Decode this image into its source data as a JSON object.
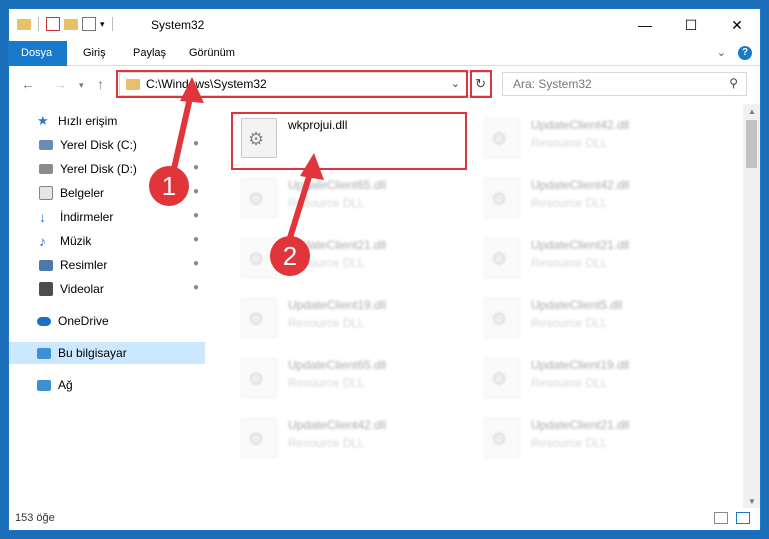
{
  "window": {
    "title": "System32"
  },
  "quick_access_toolbar": {
    "icons": [
      "folder-icon",
      "properties-icon",
      "new-folder-icon",
      "customize-icon"
    ]
  },
  "ribbon": {
    "file_tab": "Dosya",
    "tabs": [
      "Giriş",
      "Paylaş",
      "Görünüm"
    ]
  },
  "address_bar": {
    "path": "C:\\Windows\\System32"
  },
  "search": {
    "placeholder": "Ara: System32"
  },
  "nav": {
    "quick_access": "Hızlı erişim",
    "items": [
      {
        "label": "Yerel Disk (C:)",
        "icon": "drive-icon",
        "color": "#6a8db3"
      },
      {
        "label": "Yerel Disk (D:)",
        "icon": "drive-icon",
        "color": "#8b8b8b"
      },
      {
        "label": "Belgeler",
        "icon": "documents-icon",
        "color": "#7a8796"
      },
      {
        "label": "İndirmeler",
        "icon": "downloads-icon",
        "color": "#2a78d0"
      },
      {
        "label": "Müzik",
        "icon": "music-icon",
        "color": "#2a78d0"
      },
      {
        "label": "Resimler",
        "icon": "pictures-icon",
        "color": "#4b7aa8"
      },
      {
        "label": "Videolar",
        "icon": "videos-icon",
        "color": "#4d4d4d"
      }
    ],
    "onedrive": "OneDrive",
    "this_pc": "Bu bilgisayar",
    "network": "Ağ"
  },
  "files": {
    "highlighted": {
      "name": "wkprojui.dll",
      "type": ""
    },
    "items": [
      {
        "name": "UpdateClient42.dll",
        "type": "Resource DLL"
      },
      {
        "name": "UpdateClient65.dll",
        "type": "Resource DLL"
      },
      {
        "name": "UpdateClient42.dll",
        "type": "Resource DLL"
      },
      {
        "name": "UpdateClient21.dll",
        "type": "Resource DLL"
      },
      {
        "name": "UpdateClient21.dll",
        "type": "Resource DLL"
      },
      {
        "name": "UpdateClient19.dll",
        "type": "Resource DLL"
      },
      {
        "name": "UpdateClient5.dll",
        "type": "Resource DLL"
      },
      {
        "name": "UpdateClient65.dll",
        "type": "Resource DLL"
      },
      {
        "name": "UpdateClient19.dll",
        "type": "Resource DLL"
      },
      {
        "name": "UpdateClient42.dll",
        "type": "Resource DLL"
      },
      {
        "name": "UpdateClient21.dll",
        "type": "Resource DLL"
      }
    ]
  },
  "status": {
    "count": "153 öğe"
  },
  "annotations": {
    "badge1": "1",
    "badge2": "2",
    "color": "#e2353b"
  }
}
